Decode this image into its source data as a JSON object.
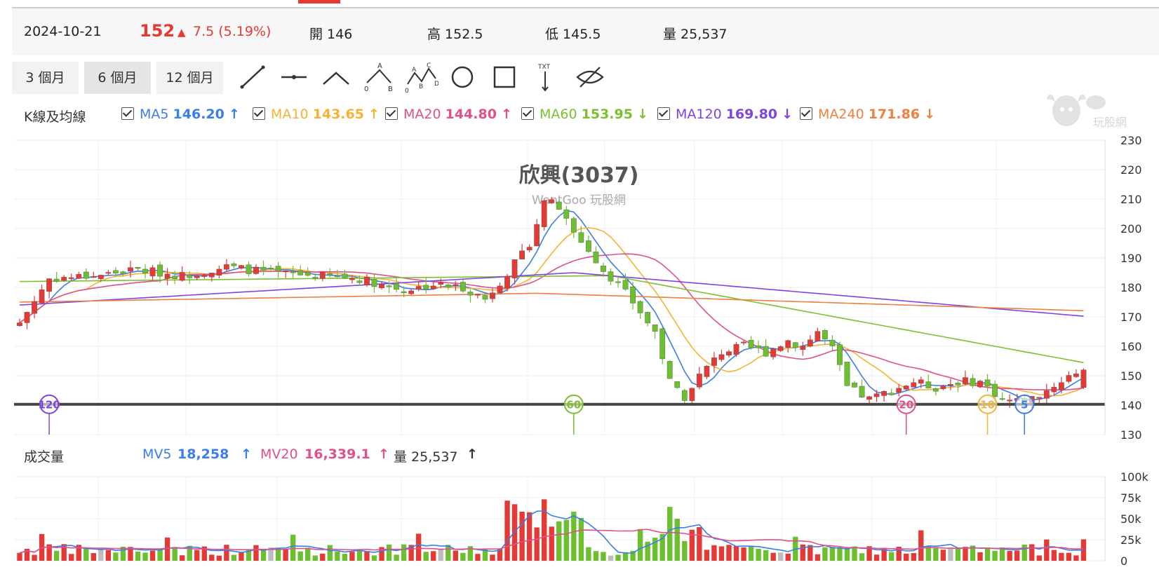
{
  "header": {
    "date": "2024-10-21",
    "price": "152",
    "change_arrow": "▲",
    "change": "7.5 (5.19%)",
    "open": "開 146",
    "high": "高 152.5",
    "low": "低 145.5",
    "volume": "量 25,537"
  },
  "toolbar": {
    "ranges": [
      "3 個月",
      "6 個月",
      "12 個月"
    ],
    "active_range": 1
  },
  "legend": {
    "label": "K線及均線",
    "items": [
      {
        "name": "MA5",
        "value": "146.20",
        "arrow": "↑",
        "color": "#3b7de9"
      },
      {
        "name": "MA10",
        "value": "143.65",
        "arrow": "↑",
        "color": "#f5b335"
      },
      {
        "name": "MA20",
        "value": "144.80",
        "arrow": "↑",
        "color": "#e0508a"
      },
      {
        "name": "MA60",
        "value": "153.95",
        "arrow": "↓",
        "color": "#7cbf2f"
      },
      {
        "name": "MA120",
        "value": "169.80",
        "arrow": "↓",
        "color": "#7f44e0"
      },
      {
        "name": "MA240",
        "value": "171.86",
        "arrow": "↓",
        "color": "#f07f40"
      }
    ]
  },
  "volume_legend": {
    "label": "成交量",
    "mv5_name": "MV5",
    "mv5_value": "18,258",
    "mv5_arrow": "↑",
    "mv20_name": "MV20",
    "mv20_value": "16,339.1",
    "mv20_arrow": "↑",
    "vol": "量 25,537",
    "vol_arrow": "↑"
  },
  "watermark": {
    "title": "欣興(3037)",
    "subtitle": "WantGoo 玩股網"
  },
  "logo_text": "玩股網",
  "colors": {
    "up": "#e53935",
    "down": "#6cbf2e",
    "neutral": "#bdbdbd"
  },
  "chart_data": {
    "type": "candlestick",
    "ylim": [
      130,
      230
    ],
    "yticks": [
      "230",
      "220",
      "210",
      "200",
      "190",
      "180",
      "170",
      "160",
      "150",
      "140",
      "130"
    ],
    "support_line": 140.3,
    "price_series_values": [
      146,
      146.5,
      147,
      148,
      149,
      149.5,
      150,
      151,
      152
    ],
    "volume_ylim": [
      0,
      100000
    ],
    "volume_ticks": [
      "100k",
      "75k",
      "50k",
      "25k",
      "0"
    ],
    "ma_markers": [
      {
        "label": "120",
        "color": "#7f44e0"
      },
      {
        "label": "60",
        "color": "#7cbf2f"
      },
      {
        "label": "20",
        "color": "#e0508a"
      },
      {
        "label": "10",
        "color": "#f5b335"
      },
      {
        "label": "5",
        "color": "#3b7de9"
      }
    ],
    "last_candle": {
      "open": 146,
      "high": 152.5,
      "low": 145.5,
      "close": 152,
      "volume": 25537
    }
  }
}
